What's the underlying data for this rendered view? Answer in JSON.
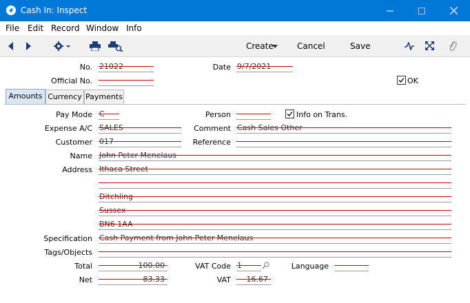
{
  "window": {
    "title": "Cash In: Inspect"
  },
  "menu": [
    "File",
    "Edit",
    "Record",
    "Window",
    "Info"
  ],
  "toolbar": {
    "create": "Create",
    "cancel": "Cancel",
    "save": "Save"
  },
  "header": {
    "no_label": "No.",
    "no_value": "21022",
    "date_label": "Date",
    "date_value": "9/7/2021",
    "official_label": "Official No.",
    "official_value": "",
    "ok_label": "OK",
    "ok_checked": true
  },
  "tabs": [
    "Amounts",
    "Currency",
    "Payments"
  ],
  "form": {
    "paymode_label": "Pay Mode",
    "paymode_value": "C",
    "person_label": "Person",
    "person_value": "",
    "infoontrans_label": "Info on Trans.",
    "infoontrans_checked": true,
    "expense_label": "Expense A/C",
    "expense_value": "SALES",
    "comment_label": "Comment",
    "comment_value": "Cash Sales Other",
    "customer_label": "Customer",
    "customer_value": "017",
    "reference_label": "Reference",
    "reference_value": "",
    "name_label": "Name",
    "name_value": "John Peter Menelaus",
    "address_label": "Address",
    "address_lines": [
      "Ithaca Street",
      "",
      "Ditchling",
      "Sussex",
      "BN6 1AA"
    ],
    "spec_label": "Specification",
    "spec_value": "Cash Payment from John Peter Menelaus",
    "tags_label": "Tags/Objects",
    "tags_value": "",
    "total_label": "Total",
    "total_value": "100.00",
    "vatcode_label": "VAT Code",
    "vatcode_value": "1",
    "language_label": "Language",
    "language_value": "",
    "net_label": "Net",
    "net_value": "83.33",
    "vat_label": "VAT",
    "vat_value": "16.67"
  },
  "colors": {
    "titlebar": "#0078d7",
    "strike": "#c00000"
  }
}
